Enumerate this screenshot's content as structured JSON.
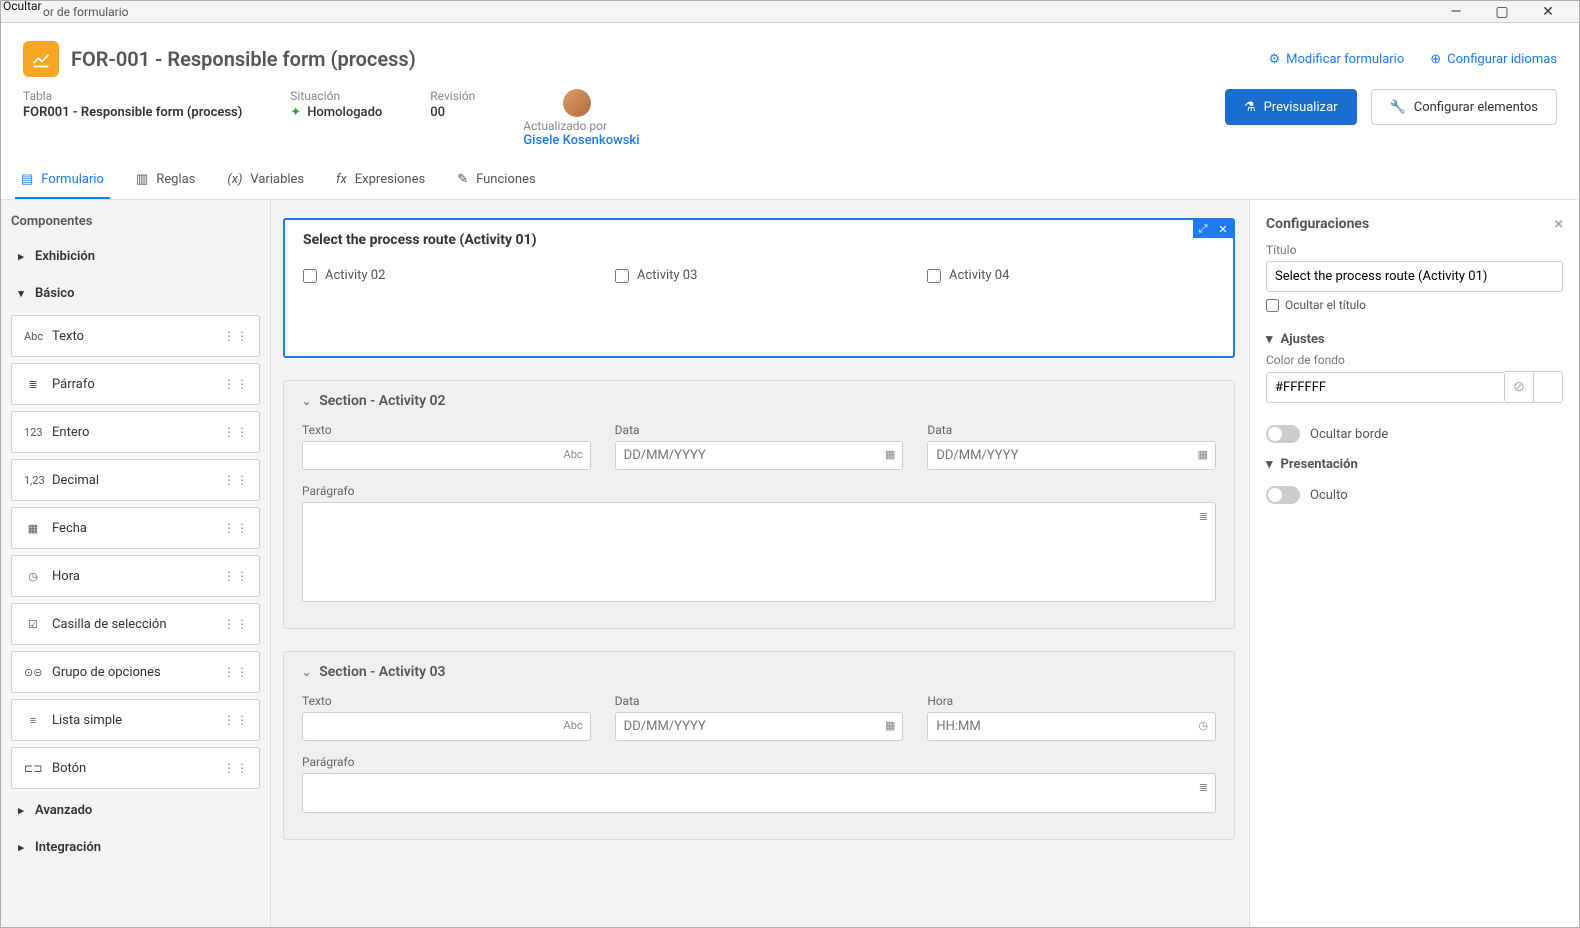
{
  "window": {
    "ocultar": "Ocultar",
    "title": "or de formulario"
  },
  "winctrls": {
    "min": "—",
    "max": "▢",
    "close": "✕"
  },
  "header": {
    "title": "FOR-001 - Responsible form (process)",
    "modify_form": "Modificar formulario",
    "config_lang": "Configurar idiomas"
  },
  "meta": {
    "table_lbl": "Tabla",
    "table_val": "FOR001 - Responsible form (process)",
    "status_lbl": "Situación",
    "status_val": "Homologado",
    "rev_lbl": "Revisión",
    "rev_val": "00",
    "updated_lbl": "Actualizado por",
    "updated_val": "Gisele Kosenkowski"
  },
  "btns": {
    "preview": "Previsualizar",
    "config_elements": "Configurar elementos"
  },
  "tabs": {
    "form": "Formulario",
    "rules": "Reglas",
    "vars": "Variables",
    "exprs": "Expresiones",
    "funcs": "Funciones"
  },
  "sidebar": {
    "title": "Componentes",
    "groups": {
      "exhibition": "Exhibición",
      "basic": "Básico",
      "advanced": "Avanzado",
      "integration": "Integración"
    },
    "basic_items": [
      {
        "icon": "Abc",
        "label": "Texto"
      },
      {
        "icon": "≣",
        "label": "Párrafo"
      },
      {
        "icon": "123",
        "label": "Entero"
      },
      {
        "icon": "1,23",
        "label": "Decimal"
      },
      {
        "icon": "▦",
        "label": "Fecha"
      },
      {
        "icon": "◷",
        "label": "Hora"
      },
      {
        "icon": "☑",
        "label": "Casilla de selección"
      },
      {
        "icon": "⊙⊝",
        "label": "Grupo de opciones"
      },
      {
        "icon": "≡",
        "label": "Lista simple"
      },
      {
        "icon": "⊏⊐",
        "label": "Botón"
      }
    ]
  },
  "canvas": {
    "section1": {
      "title": "Select the process route (Activity 01)",
      "opts": [
        "Activity 02",
        "Activity 03",
        "Activity 04"
      ]
    },
    "section2": {
      "title": "Section - Activity 02",
      "texto_lbl": "Texto",
      "data_lbl": "Data",
      "date_ph": "DD/MM/YYYY",
      "para_lbl": "Parágrafo"
    },
    "section3": {
      "title": "Section - Activity 03",
      "texto_lbl": "Texto",
      "data_lbl": "Data",
      "hora_lbl": "Hora",
      "date_ph": "DD/MM/YYYY",
      "hora_ph": "HH:MM",
      "para_lbl": "Parágrafo"
    }
  },
  "props": {
    "title": "Configuraciones",
    "titulo_lbl": "Título",
    "titulo_val": "Select the process route (Activity 01)",
    "hide_title": "Ocultar el título",
    "ajustes": "Ajustes",
    "bgcolor_lbl": "Color de fondo",
    "bgcolor_val": "#FFFFFF",
    "hide_border": "Ocultar borde",
    "presentation": "Presentación",
    "oculto": "Oculto"
  }
}
